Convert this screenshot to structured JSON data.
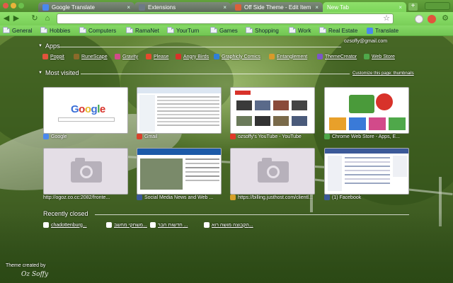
{
  "tabs": [
    {
      "title": "Google Translate",
      "favicon_color": "#4a88ee",
      "active": false
    },
    {
      "title": "Extensions",
      "favicon_color": "#6e7a86",
      "active": false
    },
    {
      "title": "Off Side Theme - Edit Item",
      "favicon_color": "#d9603a",
      "active": false
    },
    {
      "title": "New Tab",
      "favicon_color": "",
      "active": true
    }
  ],
  "toolbar": {
    "omnibox_value": "",
    "new_tab_symbol": "+",
    "back_icon": "back-arrow-icon",
    "forward_icon": "forward-arrow-icon",
    "reload_icon": "reload-icon",
    "home_icon": "home-icon"
  },
  "bookmarks": [
    {
      "label": "General",
      "type": "folder"
    },
    {
      "label": "Hobbies",
      "type": "folder"
    },
    {
      "label": "Computers",
      "type": "folder"
    },
    {
      "label": "RamaNet",
      "type": "folder"
    },
    {
      "label": "YourTurn",
      "type": "folder"
    },
    {
      "label": "Games",
      "type": "folder"
    },
    {
      "label": "Shopping",
      "type": "folder"
    },
    {
      "label": "Work",
      "type": "folder"
    },
    {
      "label": "Real Estate",
      "type": "folder"
    },
    {
      "label": "Translate",
      "type": "link"
    }
  ],
  "account": "ozsoffy@gmail.com",
  "apps_section": {
    "title": "Apps",
    "items": [
      {
        "label": "Poppit",
        "color": "#e2533c"
      },
      {
        "label": "RuneScape",
        "color": "#8b6a2a"
      },
      {
        "label": "Gravity",
        "color": "#d24a8a"
      },
      {
        "label": "Please",
        "color": "#e64a2e"
      },
      {
        "label": "Angry Birds",
        "color": "#d8322a"
      },
      {
        "label": "Graphicly Comics",
        "color": "#2f7fd8"
      },
      {
        "label": "Entanglement",
        "color": "#d79a2a"
      },
      {
        "label": "ThemeCreator",
        "color": "#7c56c8"
      },
      {
        "label": "Web Store",
        "color": "#4fa84a"
      }
    ]
  },
  "most_visited": {
    "title": "Most visited",
    "note": "Customize this page: thumbnails",
    "tiles": [
      {
        "title": "Google",
        "icon_color": "#4a88ee",
        "kind": "google"
      },
      {
        "title": "Gmail",
        "icon_color": "#d8422c",
        "kind": "gmail"
      },
      {
        "title": "ozsoffy's YouTube - YouTube",
        "icon_color": "#e03a2a",
        "kind": "youtube"
      },
      {
        "title": "Chrome Web Store - Apps, E...",
        "icon_color": "#4fa84a",
        "kind": "webstore"
      },
      {
        "title": "http://ogoz.co.cc:2082/fronte...",
        "icon_color": "",
        "kind": "empty"
      },
      {
        "title": "Social Media News and Web ...",
        "icon_color": "#3b5998",
        "kind": "mashable"
      },
      {
        "title": "https://billing.justhost.com/clientl...",
        "icon_color": "#d6a02a",
        "kind": "empty"
      },
      {
        "title": "(1) Facebook",
        "icon_color": "#3b5998",
        "kind": "facebook"
      }
    ],
    "google_logo": "Google"
  },
  "recently_closed": {
    "title": "Recently closed",
    "items": [
      {
        "label": "chadottenburg..."
      },
      {
        "label": "משחקי מחשב..."
      },
      {
        "label": "חדשות חבר ..."
      },
      {
        "label": "הקבוצה מושה רוא..."
      }
    ]
  },
  "credit": {
    "text": "Theme created by",
    "signature": "Oz Soffy"
  }
}
